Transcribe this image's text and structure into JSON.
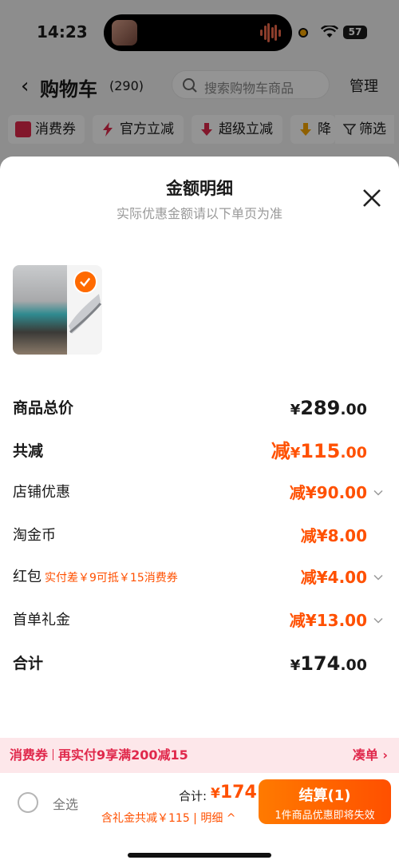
{
  "status_bar": {
    "time": "14:23",
    "battery": "57"
  },
  "header": {
    "title": "购物车",
    "count": "(290)",
    "search_placeholder": "搜索购物车商品",
    "manage": "管理"
  },
  "filters": {
    "chips": [
      {
        "label": "消费券",
        "icon": "coupon-icon",
        "color": "#e0284b"
      },
      {
        "label": "官方立减",
        "icon": "lightning-icon",
        "color": "#e0284b"
      },
      {
        "label": "超级立减",
        "icon": "arrow-down-icon",
        "color": "#e0284b"
      },
      {
        "label": "降",
        "icon": "price-drop-icon",
        "color": "#f7a600"
      }
    ],
    "filter_label": "筛选"
  },
  "sheet": {
    "title": "金额明细",
    "subtitle": "实际优惠金额请以下单页为准",
    "rows": [
      {
        "label": "商品总价",
        "prefix": "",
        "yen": "¥",
        "int": "289",
        "dec": ".00"
      },
      {
        "label": "共减",
        "prefix": "减",
        "yen": "¥",
        "int": "115",
        "dec": ".00"
      },
      {
        "label": "店铺优惠",
        "prefix": "减",
        "yen": "¥",
        "int": "90",
        "dec": ".00"
      },
      {
        "label": "淘金币",
        "prefix": "减",
        "yen": "¥",
        "int": "8",
        "dec": ".00"
      },
      {
        "label": "红包",
        "note": "实付差￥9可抵￥15消费券",
        "prefix": "减",
        "yen": "¥",
        "int": "4",
        "dec": ".00"
      },
      {
        "label": "首单礼金",
        "prefix": "减",
        "yen": "¥",
        "int": "13",
        "dec": ".00"
      },
      {
        "label": "合计",
        "prefix": "",
        "yen": "¥",
        "int": "174",
        "dec": ".00"
      }
    ]
  },
  "promo": {
    "tag": "消费券",
    "text": "再实付9享满200减15",
    "link": "凑单"
  },
  "bottom_bar": {
    "select_all": "全选",
    "total_label": "合计:",
    "total_yen": "¥",
    "total_value": "174",
    "total_detail": "含礼金共减￥115",
    "detail_link": "明细",
    "checkout_label": "结算(1)",
    "checkout_sub": "1件商品优惠即将失效"
  },
  "colors": {
    "accent": "#ff5000",
    "promo": "#e0284b"
  }
}
